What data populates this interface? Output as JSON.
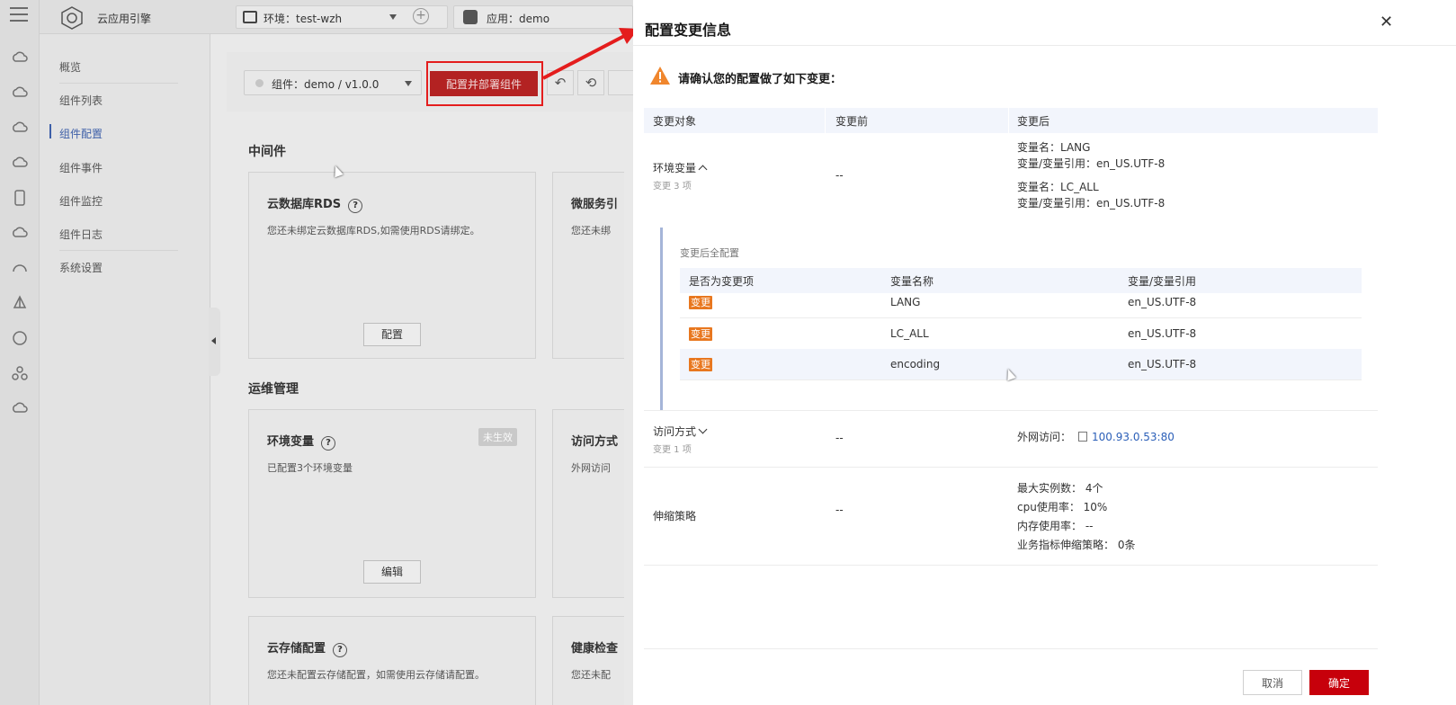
{
  "brand": "云应用引擎",
  "env_selector": {
    "label": "环境：test-wzh"
  },
  "app_selector": {
    "label": "应用：demo"
  },
  "subnav": [
    "概览",
    "组件列表",
    "组件配置",
    "组件事件",
    "组件监控",
    "组件日志",
    "系统设置"
  ],
  "component_selector": {
    "label": "组件：demo / v1.0.0"
  },
  "deploy_button": "配置并部署组件",
  "sections": {
    "middleware": "中间件",
    "ops": "运维管理"
  },
  "cards": {
    "rds": {
      "title": "云数据库RDS",
      "desc": "您还未绑定云数据库RDS,如需使用RDS请绑定。",
      "button": "配置"
    },
    "micro": {
      "title": "微服务引",
      "desc": "您还未绑"
    },
    "env": {
      "title": "环境变量",
      "badge": "未生效",
      "desc": "已配置3个环境变量",
      "button": "编辑"
    },
    "access": {
      "title": "访问方式",
      "desc": "外网访问"
    },
    "storage": {
      "title": "云存储配置",
      "desc": "您还未配置云存储配置，如需使用云存储请配置。"
    },
    "health": {
      "title": "健康检查",
      "desc": "您还未配"
    }
  },
  "drawer": {
    "title": "配置变更信息",
    "warning": "请确认您的配置做了如下变更：",
    "columns": [
      "变更对象",
      "变更前",
      "变更后"
    ],
    "rows": {
      "env": {
        "label": "环境变量",
        "sub": "变更 3 项",
        "before": "--",
        "after": [
          "变量名：LANG",
          "变量/变量引用：en_US.UTF-8",
          "变量名：LC_ALL",
          "变量/变量引用：en_US.UTF-8"
        ]
      },
      "access": {
        "label": "访问方式",
        "sub": "变更 1 项",
        "before": "--",
        "after_label": "外网访问：",
        "after_link": "100.93.0.53:80"
      },
      "scaling": {
        "label": "伸缩策略",
        "before": "--",
        "after": [
          "最大实例数：  4个",
          "cpu使用率：  10%",
          "内存使用率：  --",
          "业务指标伸缩策略：  0条"
        ]
      }
    },
    "full_config": {
      "title": "变更后全配置",
      "columns": [
        "是否为变更项",
        "变量名称",
        "变量/变量引用"
      ],
      "rows": [
        {
          "tag": "变更",
          "name": "LANG",
          "value": "en_US.UTF-8"
        },
        {
          "tag": "变更",
          "name": "LC_ALL",
          "value": "en_US.UTF-8"
        },
        {
          "tag": "变更",
          "name": "encoding",
          "value": "en_US.UTF-8"
        }
      ]
    },
    "cancel": "取消",
    "confirm": "确定"
  },
  "colors": {
    "accent": "#c7000b",
    "tag": "#e8771f",
    "link": "#2b5fb8",
    "annotation": "#e41d1d"
  }
}
